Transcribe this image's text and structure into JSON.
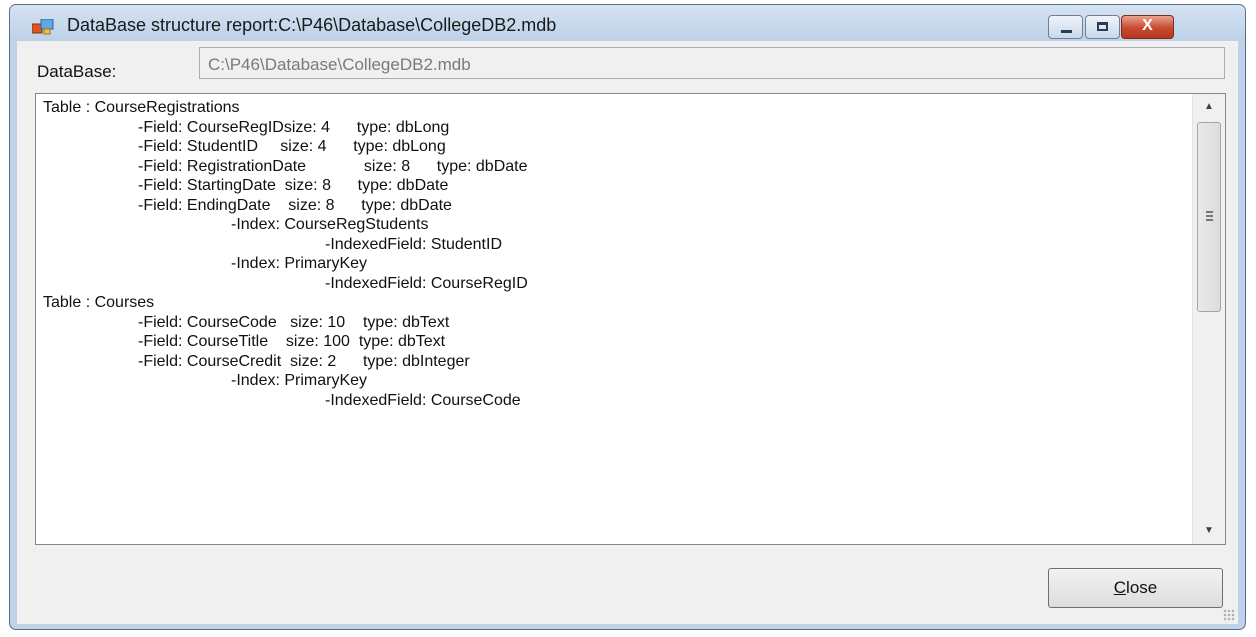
{
  "window": {
    "title": "DataBase structure report:C:\\P46\\Database\\CollegeDB2.mdb",
    "close_glyph": "X"
  },
  "database": {
    "label": "DataBase:",
    "path": "C:\\P46\\Database\\CollegeDB2.mdb"
  },
  "report": {
    "lines": [
      {
        "indent": 0,
        "text": "Table : CourseRegistrations"
      },
      {
        "indent": 1,
        "text": "-Field: CourseRegIDsize: 4      type: dbLong"
      },
      {
        "indent": 1,
        "text": "-Field: StudentID     size: 4      type: dbLong"
      },
      {
        "indent": 1,
        "text": "-Field: RegistrationDate             size: 8      type: dbDate"
      },
      {
        "indent": 1,
        "text": "-Field: StartingDate  size: 8      type: dbDate"
      },
      {
        "indent": 1,
        "text": "-Field: EndingDate    size: 8      type: dbDate"
      },
      {
        "indent": 2,
        "text": "-Index: CourseRegStudents"
      },
      {
        "indent": 3,
        "text": "-IndexedField: StudentID"
      },
      {
        "indent": 2,
        "text": "-Index: PrimaryKey"
      },
      {
        "indent": 3,
        "text": "-IndexedField: CourseRegID"
      },
      {
        "indent": 0,
        "text": "Table : Courses"
      },
      {
        "indent": 1,
        "text": "-Field: CourseCode   size: 10    type: dbText"
      },
      {
        "indent": 1,
        "text": "-Field: CourseTitle    size: 100  type: dbText"
      },
      {
        "indent": 1,
        "text": "-Field: CourseCredit  size: 2      type: dbInteger"
      },
      {
        "indent": 2,
        "text": "-Index: PrimaryKey"
      },
      {
        "indent": 3,
        "text": "-IndexedField: CourseCode"
      }
    ],
    "scroll_up_glyph": "▲",
    "scroll_down_glyph": "▼"
  },
  "footer": {
    "close_accel": "C",
    "close_rest": "lose"
  }
}
